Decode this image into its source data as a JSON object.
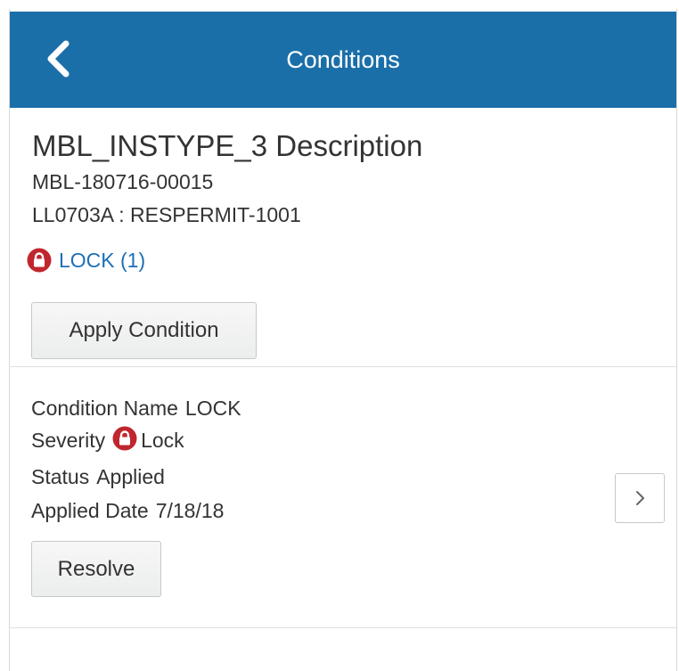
{
  "header": {
    "title": "Conditions",
    "back_icon": "chevron-left-icon",
    "background_color": "#1b6fa9"
  },
  "record": {
    "title": "MBL_INSTYPE_3 Description",
    "id": "MBL-180716-00015",
    "permit": "LL0703A : RESPERMIT-1001",
    "lock_link": "LOCK (1)",
    "lock_icon": "lock-icon",
    "apply_button": "Apply Condition"
  },
  "condition": {
    "name_label": "Condition Name",
    "name_value": "LOCK",
    "severity_label": "Severity",
    "severity_value": "Lock",
    "status_label": "Status",
    "status_value": "Applied",
    "date_label": "Applied Date",
    "date_value": "7/18/18",
    "resolve_button": "Resolve",
    "detail_icon": "chevron-right-icon"
  },
  "colors": {
    "lock_red": "#c0262e",
    "link_blue": "#1f6fb5"
  }
}
